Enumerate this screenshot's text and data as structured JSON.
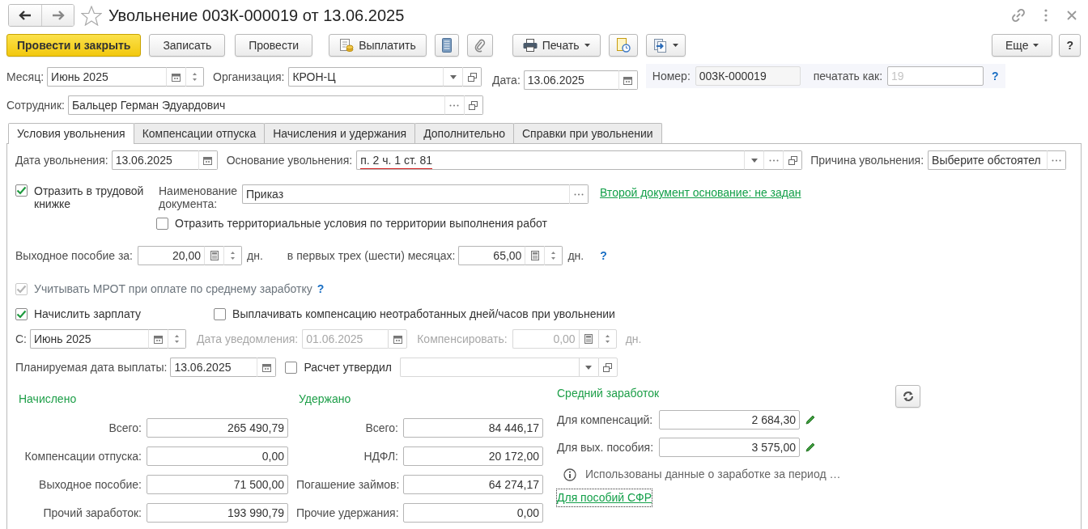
{
  "title": "Увольнение 003К-000019 от 13.06.2025",
  "toolbar": {
    "post_and_close": "Провести и закрыть",
    "save": "Записать",
    "post": "Провести",
    "pay": "Выплатить",
    "print": "Печать",
    "more": "Еще",
    "help": "?"
  },
  "header": {
    "month": {
      "label": "Месяц:",
      "value": "Июнь 2025"
    },
    "organization": {
      "label": "Организация:",
      "value": "КРОН-Ц"
    },
    "date": {
      "label": "Дата:",
      "value": "13.06.2025"
    },
    "number": {
      "label": "Номер:",
      "value": "003К-000019"
    },
    "print_as": {
      "label": "печатать как:",
      "placeholder": "19"
    },
    "help": "?",
    "employee": {
      "label": "Сотрудник:",
      "value": "Бальцер Герман Эдуардович"
    }
  },
  "tabs": [
    {
      "label": "Условия увольнения",
      "selected": true
    },
    {
      "label": "Компенсации отпуска",
      "selected": false
    },
    {
      "label": "Начисления и удержания",
      "selected": false
    },
    {
      "label": "Дополнительно",
      "selected": false
    },
    {
      "label": "Справки при увольнении",
      "selected": false
    }
  ],
  "conditions": {
    "dismissal_date": {
      "label": "Дата увольнения:",
      "value": "13.06.2025"
    },
    "basis": {
      "label": "Основание увольнения:",
      "value": "п. 2 ч. 1 ст. 81",
      "underlined": true
    },
    "reason": {
      "label": "Причина увольнения:",
      "value": "Выберите обстоятел"
    },
    "work_book": {
      "label": "Отразить в трудовой книжке",
      "checked": true,
      "disabled": false
    },
    "document_name": {
      "label": "Наименование документа:",
      "value": "Приказ"
    },
    "second_document_link": "Второй документ основание: не задан",
    "territorial": {
      "label": "Отразить территориальные условия по территории выполнения работ",
      "checked": false,
      "disabled": false
    },
    "severance": {
      "label": "Выходное пособие за:",
      "value": "20,00",
      "unit": "дн.",
      "first_months_label": "в первых трех (шести) месяцах:",
      "first_months_value": "65,00",
      "first_months_unit": "дн.",
      "help": "?"
    },
    "mrot": {
      "label": "Учитывать МРОТ при оплате по среднему заработку",
      "checked": true,
      "disabled": true,
      "help": "?"
    },
    "accrue_salary": {
      "label": "Начислить зарплату",
      "checked": true,
      "disabled": false
    },
    "pay_compensation": {
      "label": "Выплачивать компенсацию неотработанных дней/часов при увольнении",
      "checked": false,
      "disabled": false
    },
    "from": {
      "label": "С:",
      "value": "Июнь 2025"
    },
    "notice_date": {
      "label": "Дата уведомления:",
      "value": "01.06.2025",
      "disabled": true
    },
    "compensate": {
      "label": "Компенсировать:",
      "value": "0,00",
      "unit": "дн.",
      "disabled": true
    },
    "planned_payment_date": {
      "label": "Планируемая дата выплаты:",
      "value": "13.06.2025"
    },
    "calculation_approved": {
      "label": "Расчет утвердил",
      "checked": false,
      "disabled": false
    },
    "approver": {
      "disabled": true
    }
  },
  "accrued": {
    "title": "Начислено",
    "rows": [
      {
        "label": "Всего:",
        "value": "265 490,79"
      },
      {
        "label": "Компенсации отпуска:",
        "value": "0,00"
      },
      {
        "label": "Выходное пособие:",
        "value": "71 500,00"
      },
      {
        "label": "Прочий заработок:",
        "value": "193 990,79"
      }
    ]
  },
  "withheld": {
    "title": "Удержано",
    "rows": [
      {
        "label": "Всего:",
        "value": "84 446,17"
      },
      {
        "label": "НДФЛ:",
        "value": "20 172,00"
      },
      {
        "label": "Погашение займов:",
        "value": "64 274,17"
      },
      {
        "label": "Прочие удержания:",
        "value": "0,00"
      }
    ]
  },
  "average_earnings": {
    "title": "Средний заработок",
    "rows": [
      {
        "label": "Для компенсаций:",
        "value": "2 684,30"
      },
      {
        "label": "Для вых. пособия:",
        "value": "3 575,00"
      }
    ],
    "info": "Использованы данные о заработке за период …",
    "link": "Для пособий СФР"
  }
}
